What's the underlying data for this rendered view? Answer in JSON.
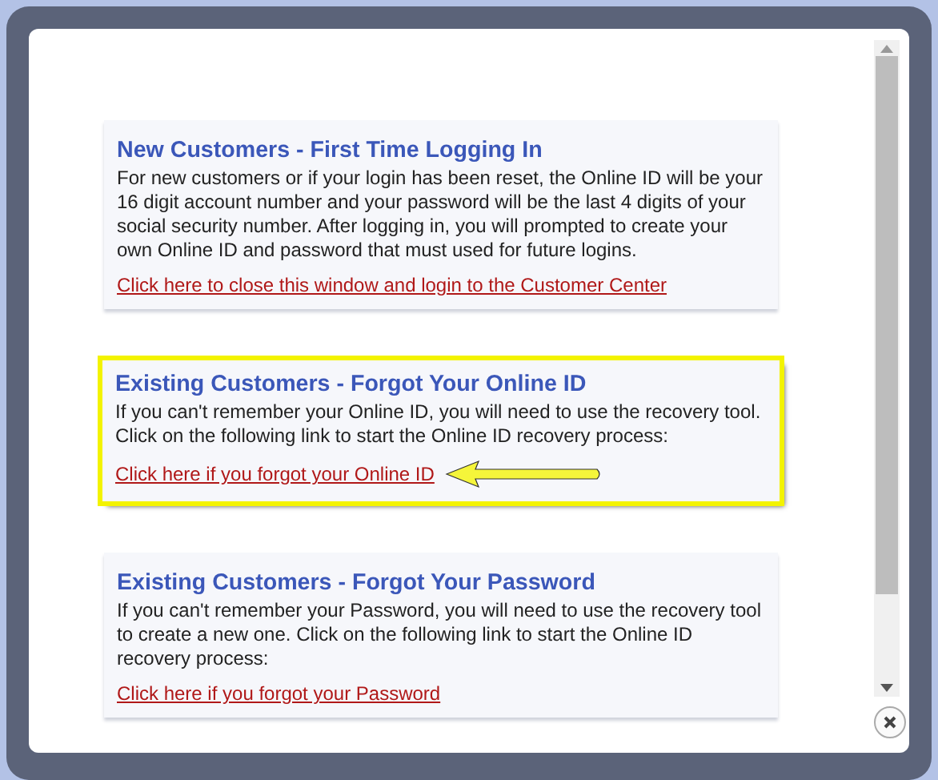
{
  "sections": [
    {
      "title": "New Customers - First Time Logging In",
      "text": "For new customers or if your login has been reset, the Online ID will be your 16 digit account number and your password will be the last 4 digits of your social security number. After logging in, you will prompted to create your own Online ID and password that must used for future logins.",
      "link": "Click here to close this window and login to the Customer Center",
      "highlighted": false
    },
    {
      "title": "Existing Customers - Forgot Your Online ID",
      "text": "If you can't remember your Online ID, you will need to use the recovery tool. Click on the following link to start the Online ID recovery process:",
      "link": "Click here if you forgot your Online ID",
      "highlighted": true
    },
    {
      "title": "Existing Customers - Forgot Your Password",
      "text": "If you can't remember your Password, you will need to use the recovery tool to create a new one. Click on the following link to start the Online ID recovery process:",
      "link": "Click here if you forgot your Password",
      "highlighted": false
    }
  ]
}
